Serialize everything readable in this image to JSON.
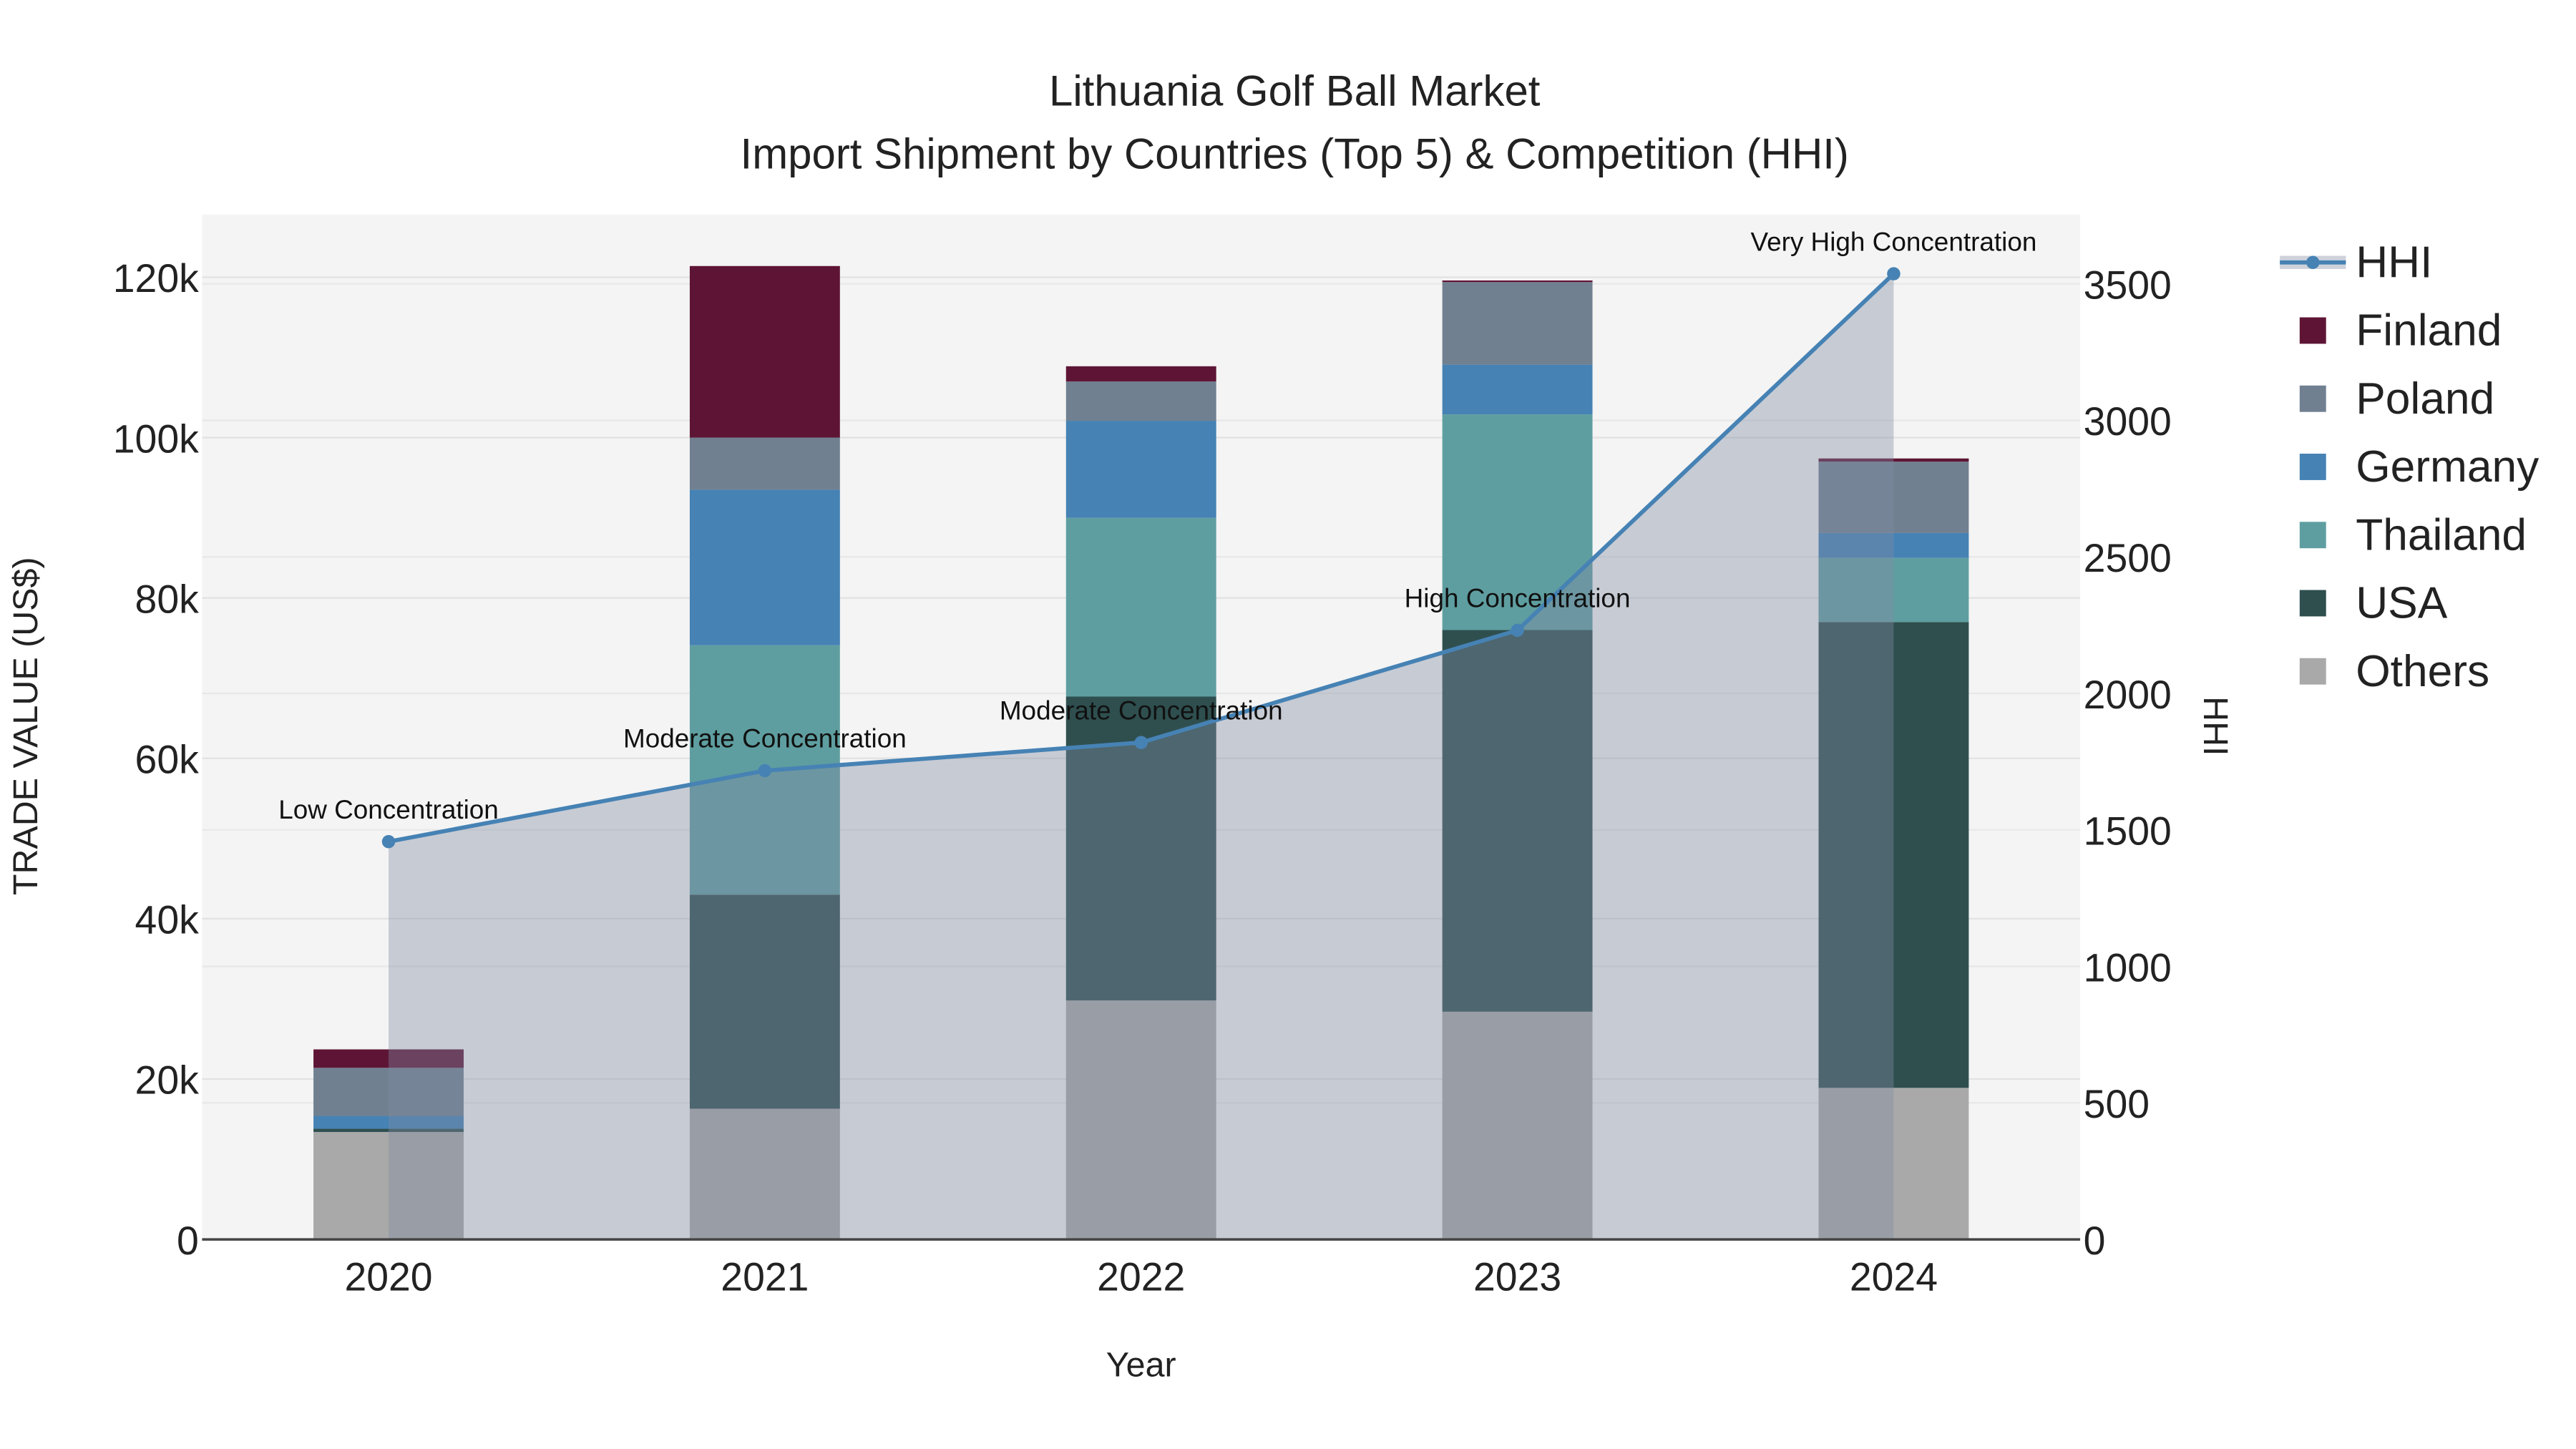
{
  "chart_data": {
    "type": "bar",
    "stacked": true,
    "title": "Lithuania Golf Ball Market",
    "subtitle": "Import Shipment by Countries (Top 5) & Competition (HHI)",
    "xlabel": "Year",
    "ylabel": "TRADE VALUE (US$)",
    "y2label": "HHI",
    "categories": [
      "2020",
      "2021",
      "2022",
      "2023",
      "2024"
    ],
    "ylim": [
      0,
      127000
    ],
    "y2lim": [
      0,
      3700
    ],
    "yticks": [
      0,
      20000,
      40000,
      60000,
      80000,
      100000,
      120000
    ],
    "ytick_labels": [
      "0",
      "20k",
      "40k",
      "60k",
      "80k",
      "100k",
      "120k"
    ],
    "y2ticks": [
      0,
      500,
      1000,
      1500,
      2000,
      2500,
      3000,
      3500
    ],
    "y2tick_labels": [
      "0",
      "500",
      "1000",
      "1500",
      "2000",
      "2500",
      "3000",
      "3500"
    ],
    "series": [
      {
        "name": "Others",
        "color": "#a9a9a9",
        "values": [
          13400,
          16300,
          29800,
          28400,
          18900
        ]
      },
      {
        "name": "USA",
        "color": "#2f4f4f",
        "values": [
          400,
          26700,
          37900,
          47600,
          58100
        ]
      },
      {
        "name": "Thailand",
        "color": "#5f9ea0",
        "values": [
          0,
          31100,
          22300,
          26900,
          8000
        ]
      },
      {
        "name": "Germany",
        "color": "#4682b4",
        "values": [
          1600,
          19400,
          12100,
          6200,
          3100
        ]
      },
      {
        "name": "Poland",
        "color": "#708090",
        "values": [
          6000,
          6500,
          4900,
          10300,
          8900
        ]
      },
      {
        "name": "Finland",
        "color": "#5e1535",
        "values": [
          2300,
          21400,
          1900,
          200,
          400
        ]
      }
    ],
    "line": {
      "name": "HHI",
      "color": "#4682b4",
      "axis": "y2",
      "values": [
        1457,
        1717,
        1820,
        2231,
        3537
      ],
      "annotations": [
        "Low Concentration",
        "Moderate Concentration",
        "Moderate Concentration",
        "High Concentration",
        "Very High Concentration"
      ]
    },
    "legend": {
      "position": "right",
      "items": [
        "HHI",
        "Finland",
        "Poland",
        "Germany",
        "Thailand",
        "USA",
        "Others"
      ]
    },
    "grid": true
  }
}
